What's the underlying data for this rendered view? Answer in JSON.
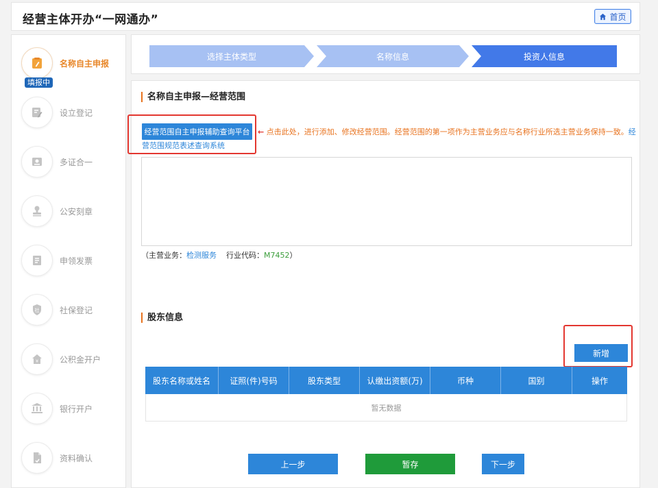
{
  "header": {
    "title": "经营主体开办“一网通办”",
    "home_label": "首页"
  },
  "sidebar": {
    "badge": "填报中",
    "items": [
      {
        "label": "名称自主申报",
        "icon": "edit-doc-icon"
      },
      {
        "label": "设立登记",
        "icon": "pen-paper-icon"
      },
      {
        "label": "多证合一",
        "icon": "certificate-icon"
      },
      {
        "label": "公安刻章",
        "icon": "stamp-icon"
      },
      {
        "label": "申领发票",
        "icon": "invoice-icon"
      },
      {
        "label": "社保登记",
        "icon": "shield-icon"
      },
      {
        "label": "公积金开户",
        "icon": "house-icon"
      },
      {
        "label": "银行开户",
        "icon": "bank-icon"
      },
      {
        "label": "资料确认",
        "icon": "document-icon"
      }
    ]
  },
  "progress": {
    "steps": [
      "选择主体类型",
      "名称信息",
      "投资人信息"
    ],
    "current": 3
  },
  "scope": {
    "section_title": "名称自主申报—经营范围",
    "platform_button": "经营范围自主申报辅助查询平台",
    "hint_arrow": "←",
    "hint_text": "点击此处，进行添加、修改经营范围。经营范围的第一项作为主营业务应与名称行业所选主营业务保持一致。",
    "hint_link_part1": "经",
    "hint_link_part2": "营范围规范表述查询系统",
    "value": "",
    "main_biz_prefix": "（主营业务：",
    "main_biz_value": "检测服务",
    "industry_code_label": "行业代码：",
    "industry_code_value": "M7452",
    "main_biz_suffix": "）"
  },
  "shareholders": {
    "section_title": "股东信息",
    "add_button": "新增",
    "columns": [
      "股东名称或姓名",
      "证照(件)号码",
      "股东类型",
      "认缴出资额(万)",
      "币种",
      "国别",
      "操作"
    ],
    "empty_text": "暂无数据"
  },
  "footer": {
    "prev_label": "上一步",
    "save_label": "暂存",
    "next_label": "下一步"
  },
  "colors": {
    "primary": "#2d86d9",
    "accent_orange": "#e8872a",
    "save_green": "#1f9b3a",
    "highlight_red": "#e3362f"
  }
}
